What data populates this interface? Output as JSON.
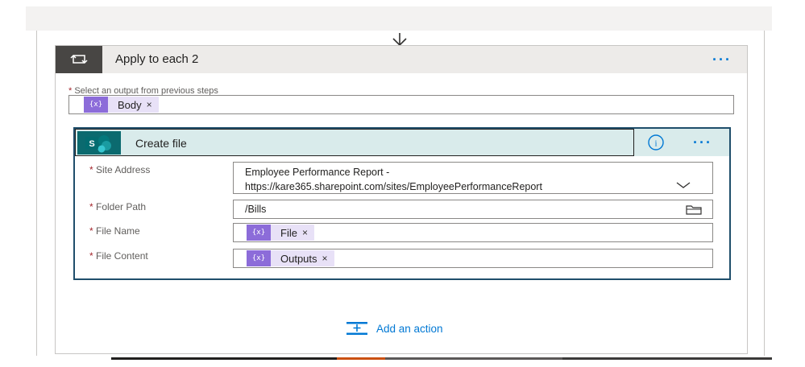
{
  "flow_step_arrow": "arrow-down-icon",
  "apply_to_each": {
    "title": "Apply to each 2",
    "more_label": "···",
    "icon": "loop-icon",
    "select_output": {
      "required_mark": "*",
      "label": "Select an output from previous steps",
      "token": {
        "icon_text": "{x}",
        "label": "Body",
        "remove": "×"
      }
    }
  },
  "create_file": {
    "title": "Create file",
    "logo_text": "S",
    "info_icon_text": "i",
    "more_label": "···",
    "fields": {
      "site_address": {
        "required_mark": "*",
        "label": "Site Address",
        "value_line1": "Employee Performance Report -",
        "value_line2": "https://kare365.sharepoint.com/sites/EmployeePerformanceReport"
      },
      "folder_path": {
        "required_mark": "*",
        "label": "Folder Path",
        "value": "/Bills"
      },
      "file_name": {
        "required_mark": "*",
        "label": "File Name",
        "token": {
          "icon_text": "{x}",
          "label": "File",
          "remove": "×"
        }
      },
      "file_content": {
        "required_mark": "*",
        "label": "File Content",
        "token": {
          "icon_text": "{x}",
          "label": "Outputs",
          "remove": "×"
        }
      }
    }
  },
  "add_action": {
    "label": "Add an action",
    "icon": "add-action-icon"
  },
  "colors": {
    "accent": "#0078d4",
    "token_icon": "#8c6cd9",
    "token_bg": "#e8e1f7",
    "sharepoint": "#0b6a6f",
    "required": "#a4262c"
  }
}
